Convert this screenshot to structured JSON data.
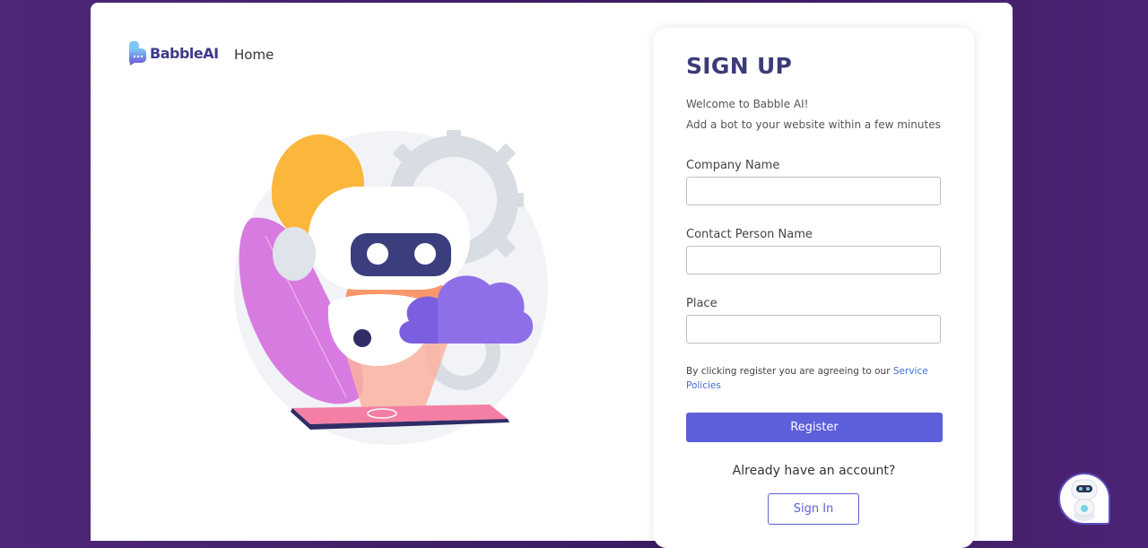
{
  "brand": {
    "name": "BabbleAI",
    "color": "#3e3a8c"
  },
  "nav": {
    "home_label": "Home"
  },
  "form": {
    "title": "SIGN UP",
    "welcome": "Welcome to Babble AI!",
    "subtitle": "Add a bot to your website within a few minutes",
    "fields": {
      "company": {
        "label": "Company Name",
        "value": "",
        "placeholder": ""
      },
      "contact": {
        "label": "Contact Person Name",
        "value": "",
        "placeholder": ""
      },
      "place": {
        "label": "Place",
        "value": "",
        "placeholder": ""
      }
    },
    "agreement_text": "By clicking register you are agreeing to our ",
    "agreement_link": "Service Policies",
    "register_label": "Register",
    "already_text": "Already have an account?",
    "signin_label": "Sign In"
  },
  "icons": {
    "logo": "chat-bubble-logo-icon",
    "hero": "robot-illustration",
    "chat_widget": "robot-chat-icon"
  },
  "colors": {
    "accent": "#5d5fdb",
    "background": "#3f1f66",
    "title": "#3c3b7a",
    "link": "#3f6fd8"
  }
}
